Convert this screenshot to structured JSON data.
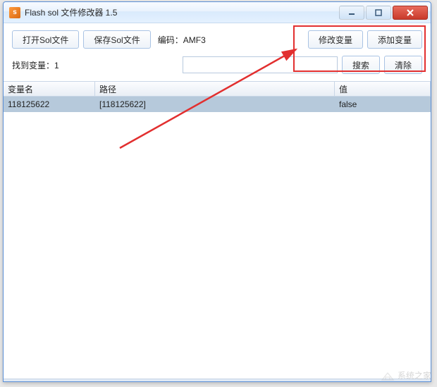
{
  "window": {
    "title": "Flash sol 文件修改器 1.5"
  },
  "toolbar": {
    "open_label": "打开Sol文件",
    "save_label": "保存Sol文件",
    "encoding_prefix": "编码：",
    "encoding_value": "AMF3",
    "modify_label": "修改变量",
    "add_label": "添加变量"
  },
  "searchbar": {
    "found_prefix": "找到变量：",
    "found_count": "1",
    "search_label": "搜索",
    "clear_label": "清除",
    "placeholder": ""
  },
  "grid": {
    "headers": {
      "name": "变量名",
      "path": "路径",
      "value": "值"
    },
    "rows": [
      {
        "name": "118125622",
        "path": "[118125622]",
        "value": "false"
      }
    ]
  },
  "watermark": "系统之家"
}
